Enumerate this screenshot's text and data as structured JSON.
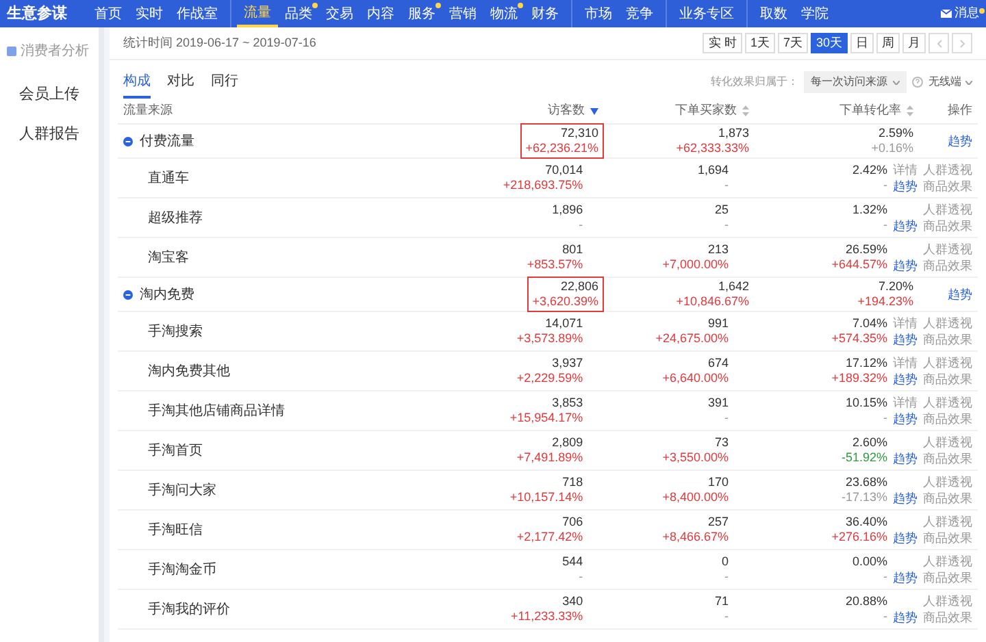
{
  "brand": "生意参谋",
  "nav_groups": [
    [
      {
        "label": "首页",
        "selected": false,
        "dot": false
      },
      {
        "label": "实时",
        "selected": false,
        "dot": false
      },
      {
        "label": "作战室",
        "selected": false,
        "dot": false
      }
    ],
    [
      {
        "label": "流量",
        "selected": true,
        "dot": false
      },
      {
        "label": "品类",
        "selected": false,
        "dot": true
      },
      {
        "label": "交易",
        "selected": false,
        "dot": false
      },
      {
        "label": "内容",
        "selected": false,
        "dot": false
      },
      {
        "label": "服务",
        "selected": false,
        "dot": true
      },
      {
        "label": "营销",
        "selected": false,
        "dot": false
      },
      {
        "label": "物流",
        "selected": false,
        "dot": true
      },
      {
        "label": "财务",
        "selected": false,
        "dot": false
      }
    ],
    [
      {
        "label": "市场",
        "selected": false,
        "dot": false
      },
      {
        "label": "竞争",
        "selected": false,
        "dot": false
      }
    ],
    [
      {
        "label": "业务专区",
        "selected": false,
        "dot": false
      }
    ],
    [
      {
        "label": "取数",
        "selected": false,
        "dot": false
      },
      {
        "label": "学院",
        "selected": false,
        "dot": false
      }
    ]
  ],
  "messages": {
    "label": "消息",
    "dot": true
  },
  "sidebar": {
    "section": "消费者分析",
    "items": [
      {
        "label": "会员上传",
        "selected": false
      },
      {
        "label": "人群报告",
        "selected": false
      }
    ]
  },
  "date_range": "统计时间 2019-06-17 ~ 2019-07-16",
  "period_buttons": [
    {
      "label": "实 时",
      "selected": false
    },
    {
      "label": "1天",
      "selected": false
    },
    {
      "label": "7天",
      "selected": false
    },
    {
      "label": "30天",
      "selected": true
    },
    {
      "label": "日",
      "selected": false
    },
    {
      "label": "周",
      "selected": false
    },
    {
      "label": "月",
      "selected": false
    }
  ],
  "tabs": [
    {
      "label": "构成",
      "selected": true
    },
    {
      "label": "对比",
      "selected": false
    },
    {
      "label": "同行",
      "selected": false
    }
  ],
  "attribution": {
    "label": "转化效果归属于：",
    "value": "每一次访问来源",
    "device": "无线端"
  },
  "table": {
    "columns": [
      {
        "label": "流量来源",
        "kind": "plain"
      },
      {
        "label": "访客数",
        "kind": "sorted"
      },
      {
        "label": "下单买家数",
        "kind": "sortable"
      },
      {
        "label": "下单转化率",
        "kind": "sortable"
      },
      {
        "label": "操作",
        "kind": "plain"
      }
    ],
    "rows": [
      {
        "kind": "group",
        "highlighted": true,
        "cells": [
          {
            "text": "付费流量"
          },
          {
            "value": "72,310",
            "change": "+62,236.21%",
            "kind": "increase"
          },
          {
            "value": "1,873",
            "change": "+62,333.33%",
            "kind": "increase"
          },
          {
            "value": "2.59%",
            "change": "+0.16%",
            "kind": "neutral"
          },
          {
            "actions": [
              {
                "label": "趋势",
                "kind": "link"
              }
            ]
          }
        ]
      },
      {
        "kind": "child",
        "highlighted": false,
        "cells": [
          {
            "text": "直通车"
          },
          {
            "value": "70,014",
            "change": "+218,693.75%",
            "kind": "increase"
          },
          {
            "value": "1,694",
            "change": "-",
            "kind": "neutral"
          },
          {
            "value": "2.42%",
            "change": "-",
            "kind": "neutral"
          },
          {
            "actions": [
              {
                "label": "详情",
                "kind": "plain"
              },
              {
                "label": "人群透视",
                "kind": "plain"
              },
              {
                "label": "趋势",
                "kind": "link"
              },
              {
                "label": "商品效果",
                "kind": "plain"
              }
            ]
          }
        ]
      },
      {
        "kind": "child",
        "highlighted": false,
        "cells": [
          {
            "text": "超级推荐"
          },
          {
            "value": "1,896",
            "change": "-",
            "kind": "neutral"
          },
          {
            "value": "25",
            "change": "-",
            "kind": "neutral"
          },
          {
            "value": "1.32%",
            "change": "-",
            "kind": "neutral"
          },
          {
            "actions": [
              {
                "label": "人群透视",
                "kind": "plain"
              },
              {
                "label": "趋势",
                "kind": "link"
              },
              {
                "label": "商品效果",
                "kind": "plain"
              }
            ]
          }
        ]
      },
      {
        "kind": "child",
        "highlighted": false,
        "cells": [
          {
            "text": "淘宝客"
          },
          {
            "value": "801",
            "change": "+853.57%",
            "kind": "increase"
          },
          {
            "value": "213",
            "change": "+7,000.00%",
            "kind": "increase"
          },
          {
            "value": "26.59%",
            "change": "+644.57%",
            "kind": "increase"
          },
          {
            "actions": [
              {
                "label": "人群透视",
                "kind": "plain"
              },
              {
                "label": "趋势",
                "kind": "link"
              },
              {
                "label": "商品效果",
                "kind": "plain"
              }
            ]
          }
        ]
      },
      {
        "kind": "group",
        "highlighted": true,
        "cells": [
          {
            "text": "淘内免费"
          },
          {
            "value": "22,806",
            "change": "+3,620.39%",
            "kind": "increase"
          },
          {
            "value": "1,642",
            "change": "+10,846.67%",
            "kind": "increase"
          },
          {
            "value": "7.20%",
            "change": "+194.23%",
            "kind": "increase"
          },
          {
            "actions": [
              {
                "label": "趋势",
                "kind": "link"
              }
            ]
          }
        ]
      },
      {
        "kind": "child",
        "highlighted": false,
        "cells": [
          {
            "text": "手淘搜索"
          },
          {
            "value": "14,071",
            "change": "+3,573.89%",
            "kind": "increase"
          },
          {
            "value": "991",
            "change": "+24,675.00%",
            "kind": "increase"
          },
          {
            "value": "7.04%",
            "change": "+574.35%",
            "kind": "increase"
          },
          {
            "actions": [
              {
                "label": "详情",
                "kind": "plain"
              },
              {
                "label": "人群透视",
                "kind": "plain"
              },
              {
                "label": "趋势",
                "kind": "link"
              },
              {
                "label": "商品效果",
                "kind": "plain"
              }
            ]
          }
        ]
      },
      {
        "kind": "child",
        "highlighted": false,
        "cells": [
          {
            "text": "淘内免费其他"
          },
          {
            "value": "3,937",
            "change": "+2,229.59%",
            "kind": "increase"
          },
          {
            "value": "674",
            "change": "+6,640.00%",
            "kind": "increase"
          },
          {
            "value": "17.12%",
            "change": "+189.32%",
            "kind": "increase"
          },
          {
            "actions": [
              {
                "label": "详情",
                "kind": "plain"
              },
              {
                "label": "人群透视",
                "kind": "plain"
              },
              {
                "label": "趋势",
                "kind": "link"
              },
              {
                "label": "商品效果",
                "kind": "plain"
              }
            ]
          }
        ]
      },
      {
        "kind": "child",
        "highlighted": false,
        "cells": [
          {
            "text": "手淘其他店铺商品详情"
          },
          {
            "value": "3,853",
            "change": "+15,954.17%",
            "kind": "increase"
          },
          {
            "value": "391",
            "change": "-",
            "kind": "neutral"
          },
          {
            "value": "10.15%",
            "change": "-",
            "kind": "neutral"
          },
          {
            "actions": [
              {
                "label": "详情",
                "kind": "plain"
              },
              {
                "label": "人群透视",
                "kind": "plain"
              },
              {
                "label": "趋势",
                "kind": "link"
              },
              {
                "label": "商品效果",
                "kind": "plain"
              }
            ]
          }
        ]
      },
      {
        "kind": "child",
        "highlighted": false,
        "cells": [
          {
            "text": "手淘首页"
          },
          {
            "value": "2,809",
            "change": "+7,491.89%",
            "kind": "increase"
          },
          {
            "value": "73",
            "change": "+3,550.00%",
            "kind": "increase"
          },
          {
            "value": "2.60%",
            "change": "-51.92%",
            "kind": "decrease"
          },
          {
            "actions": [
              {
                "label": "人群透视",
                "kind": "plain"
              },
              {
                "label": "趋势",
                "kind": "link"
              },
              {
                "label": "商品效果",
                "kind": "plain"
              }
            ]
          }
        ]
      },
      {
        "kind": "child",
        "highlighted": false,
        "cells": [
          {
            "text": "手淘问大家"
          },
          {
            "value": "718",
            "change": "+10,157.14%",
            "kind": "increase"
          },
          {
            "value": "170",
            "change": "+8,400.00%",
            "kind": "increase"
          },
          {
            "value": "23.68%",
            "change": "-17.13%",
            "kind": "neutral"
          },
          {
            "actions": [
              {
                "label": "人群透视",
                "kind": "plain"
              },
              {
                "label": "趋势",
                "kind": "link"
              },
              {
                "label": "商品效果",
                "kind": "plain"
              }
            ]
          }
        ]
      },
      {
        "kind": "child",
        "highlighted": false,
        "cells": [
          {
            "text": "手淘旺信"
          },
          {
            "value": "706",
            "change": "+2,177.42%",
            "kind": "increase"
          },
          {
            "value": "257",
            "change": "+8,466.67%",
            "kind": "increase"
          },
          {
            "value": "36.40%",
            "change": "+276.16%",
            "kind": "increase"
          },
          {
            "actions": [
              {
                "label": "人群透视",
                "kind": "plain"
              },
              {
                "label": "趋势",
                "kind": "link"
              },
              {
                "label": "商品效果",
                "kind": "plain"
              }
            ]
          }
        ]
      },
      {
        "kind": "child",
        "highlighted": false,
        "cells": [
          {
            "text": "手淘淘金币"
          },
          {
            "value": "544",
            "change": "-",
            "kind": "neutral"
          },
          {
            "value": "0",
            "change": "-",
            "kind": "neutral"
          },
          {
            "value": "0.00%",
            "change": "-",
            "kind": "neutral"
          },
          {
            "actions": [
              {
                "label": "人群透视",
                "kind": "plain"
              },
              {
                "label": "趋势",
                "kind": "link"
              },
              {
                "label": "商品效果",
                "kind": "plain"
              }
            ]
          }
        ]
      },
      {
        "kind": "child",
        "highlighted": false,
        "cells": [
          {
            "text": "手淘我的评价"
          },
          {
            "value": "340",
            "change": "+11,233.33%",
            "kind": "increase"
          },
          {
            "value": "71",
            "change": "-",
            "kind": "neutral"
          },
          {
            "value": "20.88%",
            "change": "-",
            "kind": "neutral"
          },
          {
            "actions": [
              {
                "label": "人群透视",
                "kind": "plain"
              },
              {
                "label": "趋势",
                "kind": "link"
              },
              {
                "label": "商品效果",
                "kind": "plain"
              }
            ]
          }
        ]
      }
    ]
  }
}
